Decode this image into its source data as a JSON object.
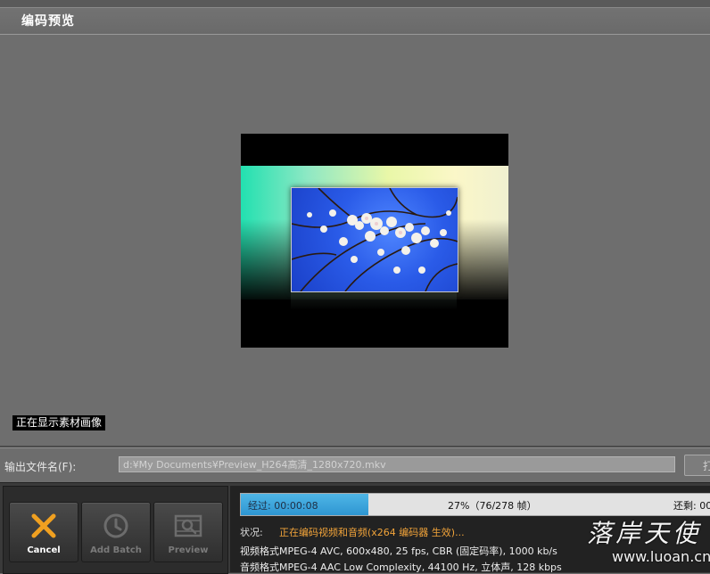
{
  "header": {
    "title": "编码预览"
  },
  "preview": {
    "status_tag": "正在显示素材画像"
  },
  "output": {
    "label": "输出文件名(F):",
    "path": "d:¥My Documents¥Preview_H264高清_1280x720.mkv",
    "browse_label": "打"
  },
  "buttons": {
    "cancel": "Cancel",
    "add_batch": "Add Batch",
    "preview": "Preview"
  },
  "progress": {
    "elapsed": "经过: 00:00:08",
    "percent_text": "27%（76/278 帧）",
    "percent_value": 27,
    "remaining": "还剩: 00"
  },
  "status": {
    "label": "状况:",
    "value": "正在编码视频和音频(x264 编码器 生效)..."
  },
  "formats": {
    "video": "视频格式MPEG-4 AVC, 600x480, 25 fps, CBR (固定码率), 1000 kb/s",
    "audio": "音频格式MPEG-4 AAC Low Complexity, 44100 Hz, 立体声, 128 kbps"
  },
  "watermark": {
    "cn": "落岸天使",
    "url": "www.luoan.cn"
  },
  "colors": {
    "accent_orange": "#f2a43a",
    "progress_blue": "#2e96d2",
    "cancel_icon": "#f0a020"
  },
  "icons": {
    "cancel": "close-x-icon",
    "add_batch": "clock-icon",
    "preview": "film-magnifier-icon"
  }
}
